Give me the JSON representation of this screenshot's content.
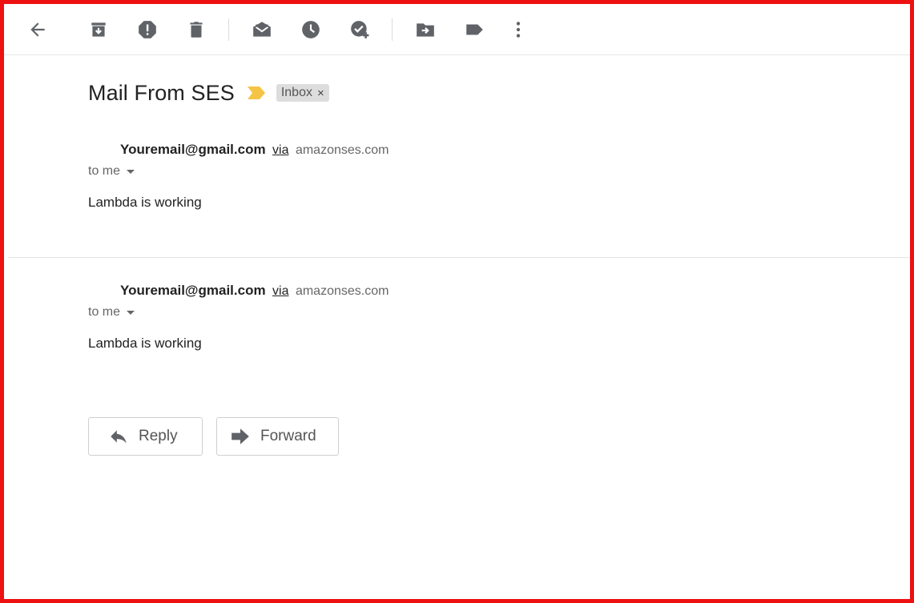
{
  "toolbar": {
    "buttons": [
      {
        "name": "back-icon"
      },
      {
        "name": "archive-icon"
      },
      {
        "name": "report-spam-icon"
      },
      {
        "name": "delete-icon"
      },
      {
        "name": "mark-unread-icon"
      },
      {
        "name": "snooze-icon"
      },
      {
        "name": "add-to-tasks-icon"
      },
      {
        "name": "move-to-icon"
      },
      {
        "name": "label-icon"
      },
      {
        "name": "more-options-icon"
      }
    ],
    "icon_color": "#5f6368"
  },
  "thread": {
    "subject": "Mail From SES",
    "importance_color": "#f6c445",
    "label": "Inbox",
    "label_remove": "×"
  },
  "messages": [
    {
      "sender_email": "Youremail@gmail.com",
      "via": "via",
      "via_domain": "amazonses.com",
      "to": "to me",
      "body": "Lambda is working"
    },
    {
      "sender_email": "Youremail@gmail.com",
      "via": "via",
      "via_domain": "amazonses.com",
      "to": "to me",
      "body": "Lambda is working"
    }
  ],
  "actions": {
    "reply": "Reply",
    "forward": "Forward"
  },
  "frame_color": "#ee1111"
}
